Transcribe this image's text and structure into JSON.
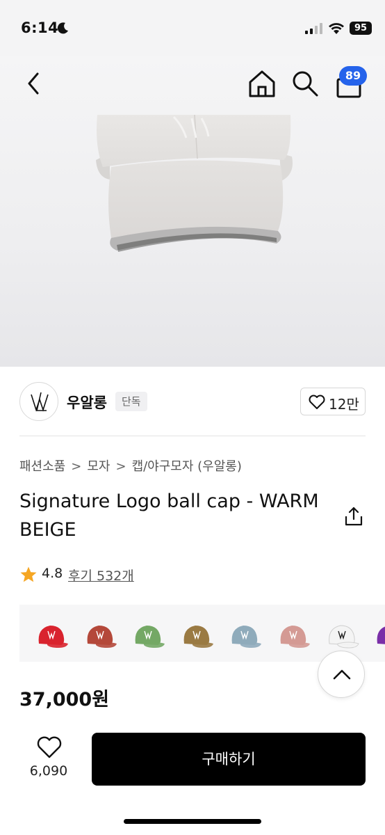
{
  "status_bar": {
    "time": "6:14",
    "battery": "95"
  },
  "header": {
    "cart_count": "89"
  },
  "brand": {
    "name": "우알롱",
    "tag": "단독",
    "likes": "12만"
  },
  "breadcrumb": [
    "패션소품",
    "모자",
    "캡/야구모자 (우알롱)"
  ],
  "breadcrumb_separator": ">",
  "product": {
    "title": "Signature Logo ball cap - WARM BEIGE",
    "rating": "4.8",
    "reviews": "후기 532개",
    "price": "37,000원"
  },
  "color_options": [
    {
      "name": "red",
      "color": "#d9232e"
    },
    {
      "name": "brick",
      "color": "#b4483a"
    },
    {
      "name": "green",
      "color": "#74a865"
    },
    {
      "name": "brown",
      "color": "#9a7a43"
    },
    {
      "name": "sky-blue",
      "color": "#8fabbb"
    },
    {
      "name": "pink",
      "color": "#d49a94"
    },
    {
      "name": "white",
      "color": "#f4f4f4"
    },
    {
      "name": "purple",
      "color": "#7a2fa8"
    }
  ],
  "bottom_bar": {
    "likes": "6,090",
    "buy_label": "구매하기"
  },
  "icons": [
    "back-icon",
    "home-icon",
    "search-icon",
    "bag-icon",
    "heart-icon",
    "share-icon",
    "star-icon",
    "chevron-up-icon"
  ],
  "accent_colors": {
    "badge": "#2563eb",
    "star": "#f5a623",
    "buy": "#000000"
  }
}
